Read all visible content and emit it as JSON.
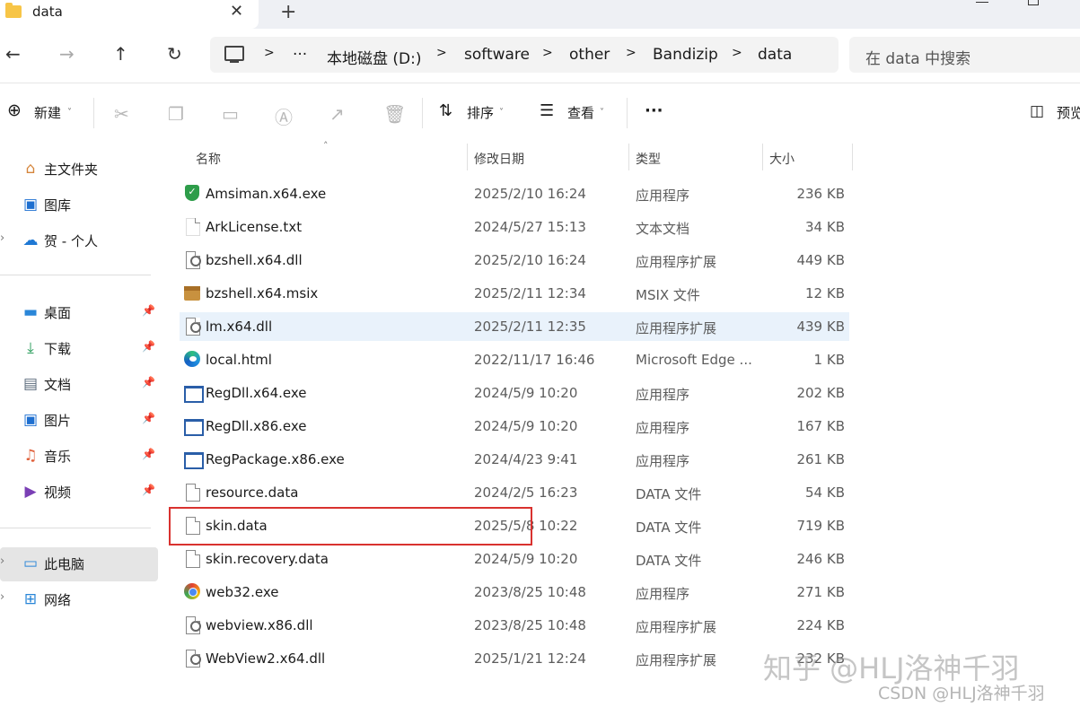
{
  "tab": {
    "title": "data",
    "close": "✕",
    "new_tab": "+"
  },
  "nav": {
    "back": "←",
    "forward": "→",
    "up": "↑",
    "refresh": "↻"
  },
  "address": {
    "more": "···",
    "separator": ">",
    "crumbs": [
      "本地磁盘 (D:)",
      "software",
      "other",
      "Bandizip",
      "data"
    ]
  },
  "search": {
    "placeholder": "在 data 中搜索"
  },
  "toolbar": {
    "new_label": "新建",
    "sort_label": "排序",
    "view_label": "查看",
    "more": "···",
    "preview_label": "预览"
  },
  "sidebar": {
    "items": [
      {
        "label": "主文件夹",
        "icon": "home-icon"
      },
      {
        "label": "图库",
        "icon": "gallery-icon"
      },
      {
        "label": "贺 - 个人",
        "icon": "cloud-icon"
      },
      {
        "label": "桌面",
        "icon": "desktop-icon"
      },
      {
        "label": "下载",
        "icon": "download-icon"
      },
      {
        "label": "文档",
        "icon": "documents-icon"
      },
      {
        "label": "图片",
        "icon": "pictures-icon"
      },
      {
        "label": "音乐",
        "icon": "music-icon"
      },
      {
        "label": "视频",
        "icon": "videos-icon"
      },
      {
        "label": "此电脑",
        "icon": "this-pc-icon"
      },
      {
        "label": "网络",
        "icon": "network-icon"
      }
    ]
  },
  "columns": {
    "name": "名称",
    "date": "修改日期",
    "type": "类型",
    "size": "大小"
  },
  "files": [
    {
      "name": "Amsiman.x64.exe",
      "date": "2025/2/10 16:24",
      "type": "应用程序",
      "size": "236 KB",
      "icon": "shield-exe-icon"
    },
    {
      "name": "ArkLicense.txt",
      "date": "2024/5/27 15:13",
      "type": "文本文档",
      "size": "34 KB",
      "icon": "text-file-icon"
    },
    {
      "name": "bzshell.x64.dll",
      "date": "2025/2/10 16:24",
      "type": "应用程序扩展",
      "size": "449 KB",
      "icon": "dll-icon"
    },
    {
      "name": "bzshell.x64.msix",
      "date": "2025/2/11 12:34",
      "type": "MSIX 文件",
      "size": "12 KB",
      "icon": "package-icon"
    },
    {
      "name": "lm.x64.dll",
      "date": "2025/2/11 12:35",
      "type": "应用程序扩展",
      "size": "439 KB",
      "icon": "dll-icon"
    },
    {
      "name": "local.html",
      "date": "2022/11/17 16:46",
      "type": "Microsoft Edge ...",
      "size": "1 KB",
      "icon": "edge-icon"
    },
    {
      "name": "RegDll.x64.exe",
      "date": "2024/5/9 10:20",
      "type": "应用程序",
      "size": "202 KB",
      "icon": "app-window-icon"
    },
    {
      "name": "RegDll.x86.exe",
      "date": "2024/5/9 10:20",
      "type": "应用程序",
      "size": "167 KB",
      "icon": "app-window-icon"
    },
    {
      "name": "RegPackage.x86.exe",
      "date": "2024/4/23 9:41",
      "type": "应用程序",
      "size": "261 KB",
      "icon": "app-window-icon"
    },
    {
      "name": "resource.data",
      "date": "2024/2/5 16:23",
      "type": "DATA 文件",
      "size": "54 KB",
      "icon": "blank-file-icon"
    },
    {
      "name": "skin.data",
      "date": "2025/5/8 10:22",
      "type": "DATA 文件",
      "size": "719 KB",
      "icon": "blank-file-icon"
    },
    {
      "name": "skin.recovery.data",
      "date": "2024/5/9 10:20",
      "type": "DATA 文件",
      "size": "246 KB",
      "icon": "blank-file-icon"
    },
    {
      "name": "web32.exe",
      "date": "2023/8/25 10:48",
      "type": "应用程序",
      "size": "271 KB",
      "icon": "chrome-like-icon"
    },
    {
      "name": "webview.x86.dll",
      "date": "2023/8/25 10:48",
      "type": "应用程序扩展",
      "size": "224 KB",
      "icon": "dll-icon"
    },
    {
      "name": "WebView2.x64.dll",
      "date": "2025/1/21 12:24",
      "type": "应用程序扩展",
      "size": "232 KB",
      "icon": "dll-icon"
    }
  ],
  "watermark": {
    "main": "知乎 @HLJ洛神千羽",
    "csdn": "CSDN @HLJ洛神千羽"
  }
}
